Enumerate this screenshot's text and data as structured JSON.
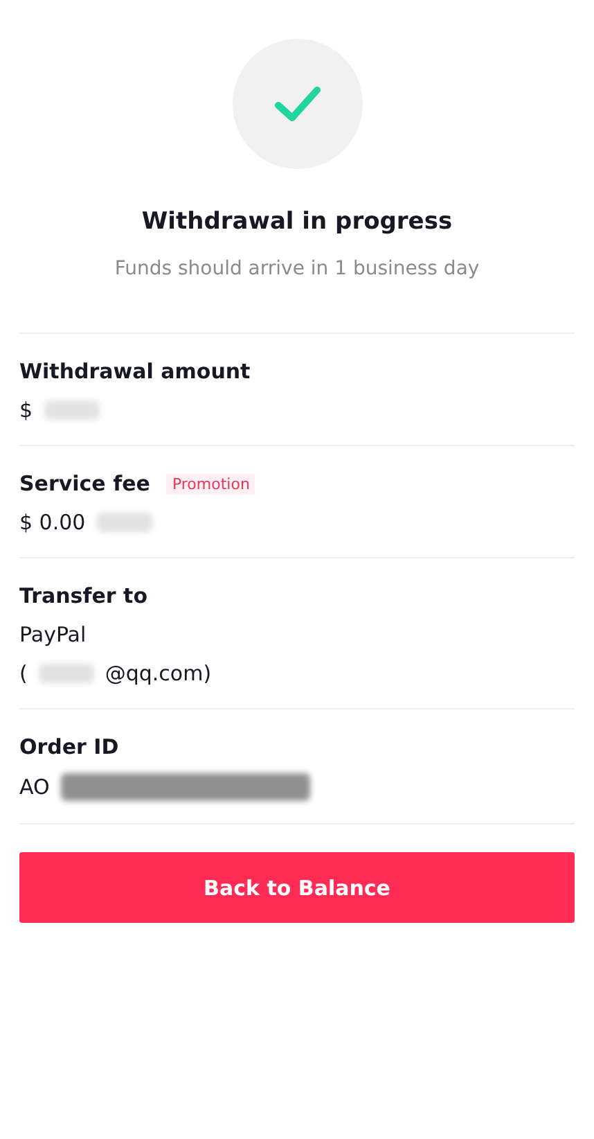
{
  "status": {
    "title": "Withdrawal in progress",
    "subtitle": "Funds should arrive in 1 business day"
  },
  "details": [
    {
      "label": "Withdrawal amount",
      "lines": [
        [
          {
            "kind": "text",
            "text": "$"
          },
          {
            "kind": "blur"
          }
        ]
      ]
    },
    {
      "label": "Service fee",
      "tag": "Promotion",
      "lines": [
        [
          {
            "kind": "text",
            "text": "$ 0.00"
          },
          {
            "kind": "blur"
          }
        ]
      ]
    },
    {
      "label": "Transfer to",
      "lines": [
        [
          {
            "kind": "text",
            "text": "PayPal"
          }
        ],
        [
          {
            "kind": "text",
            "text": "("
          },
          {
            "kind": "blur"
          },
          {
            "kind": "text",
            "text": "@qq.com)"
          }
        ]
      ]
    },
    {
      "label": "Order ID",
      "lines": [
        [
          {
            "kind": "text",
            "text": "AO"
          },
          {
            "kind": "scribble"
          }
        ]
      ]
    }
  ],
  "button": {
    "label": "Back to Balance"
  }
}
